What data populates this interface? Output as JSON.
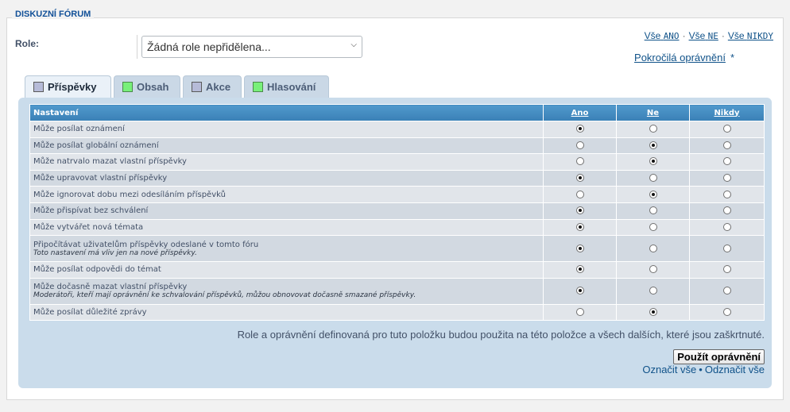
{
  "fieldset": {
    "legend": "DISKUZNÍ FÓRUM"
  },
  "role": {
    "label": "Role:",
    "selected": "Žádná role nepřidělena..."
  },
  "quick_links": {
    "all_prefix_1": "Vše",
    "all_yes": "ANO",
    "all_prefix_2": "Vše",
    "all_no": "NE",
    "all_prefix_3": "Vše",
    "all_never": "NIKDY",
    "separator": "·",
    "advanced": "Pokročilá oprávnění",
    "advanced_star": "*"
  },
  "tabs": [
    {
      "label": "Příspěvky",
      "color": "#b6bbd8",
      "active": true
    },
    {
      "label": "Obsah",
      "color": "#78f07a",
      "active": false
    },
    {
      "label": "Akce",
      "color": "#b6bbd8",
      "active": false
    },
    {
      "label": "Hlasování",
      "color": "#78f07a",
      "active": false
    }
  ],
  "table": {
    "headers": {
      "setting": "Nastavení",
      "yes": "Ano",
      "no": "Ne",
      "never": "Nikdy"
    },
    "rows": [
      {
        "label": "Může posílat oznámení",
        "note": "",
        "value": "yes"
      },
      {
        "label": "Může posílat globální oznámení",
        "note": "",
        "value": "no"
      },
      {
        "label": "Může natrvalo mazat vlastní příspěvky",
        "note": "",
        "value": "no"
      },
      {
        "label": "Může upravovat vlastní příspěvky",
        "note": "",
        "value": "yes"
      },
      {
        "label": "Může ignorovat dobu mezi odesíláním příspěvků",
        "note": "",
        "value": "no"
      },
      {
        "label": "Může přispívat bez schválení",
        "note": "",
        "value": "yes"
      },
      {
        "label": "Může vytvářet nová témata",
        "note": "",
        "value": "yes"
      },
      {
        "label": "Připočítávat uživatelům příspěvky odeslané v tomto fóru",
        "note": "Toto nastavení má vliv jen na nové příspěvky.",
        "value": "yes"
      },
      {
        "label": "Může posílat odpovědi do témat",
        "note": "",
        "value": "yes"
      },
      {
        "label": "Může dočasně mazat vlastní příspěvky",
        "note": "Moderátoři, kteří mají oprávnění ke schvalování příspěvků, můžou obnovovat dočasně smazané příspěvky.",
        "value": "yes"
      },
      {
        "label": "Může posílat důležité zprávy",
        "note": "",
        "value": "no"
      }
    ]
  },
  "footnote": "Role a oprávnění definovaná pro tuto položku budou použita na této položce a všech dalších, které jsou zaškrtnuté.",
  "apply_button": "Použít oprávnění",
  "mark_links": {
    "mark_all": "Označit vše",
    "bullet": "•",
    "unmark_all": "Odznačit vše"
  }
}
